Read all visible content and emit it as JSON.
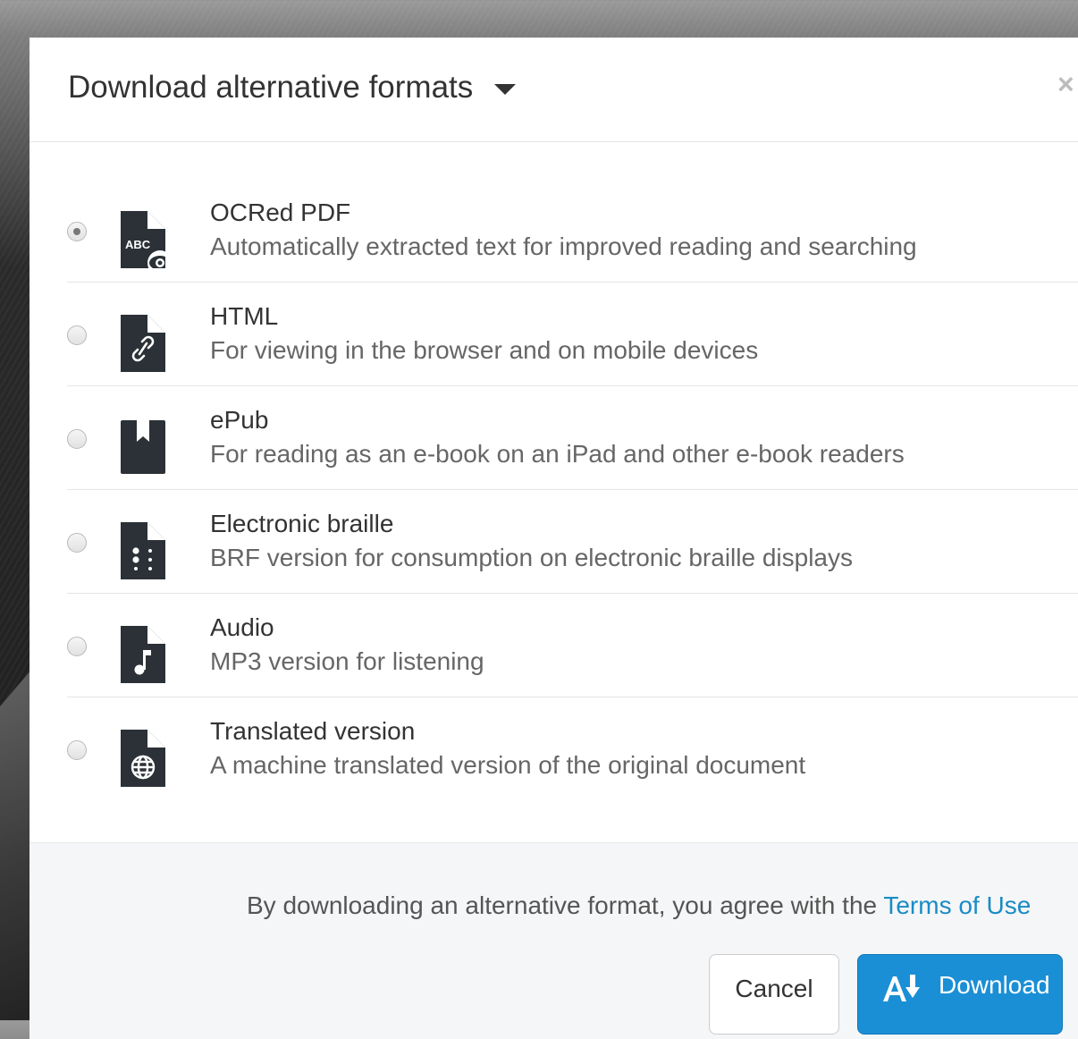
{
  "modal": {
    "title": "Download alternative formats",
    "close_label": "×"
  },
  "options": [
    {
      "title": "OCRed PDF",
      "description": "Automatically extracted text for improved reading and searching",
      "icon": "ocr-pdf-icon",
      "selected": true
    },
    {
      "title": "HTML",
      "description": "For viewing in the browser and on mobile devices",
      "icon": "html-link-icon",
      "selected": false
    },
    {
      "title": "ePub",
      "description": "For reading as an e-book on an iPad and other e-book readers",
      "icon": "epub-bookmark-icon",
      "selected": false
    },
    {
      "title": "Electronic braille",
      "description": "BRF version for consumption on electronic braille displays",
      "icon": "braille-icon",
      "selected": false
    },
    {
      "title": "Audio",
      "description": "MP3 version for listening",
      "icon": "audio-note-icon",
      "selected": false
    },
    {
      "title": "Translated version",
      "description": "A machine translated version of the original document",
      "icon": "globe-icon",
      "selected": false
    }
  ],
  "footer": {
    "terms_text": "By downloading an alternative format, you agree with the ",
    "terms_link": "Terms of Use",
    "cancel_label": "Cancel",
    "download_label": "Download"
  },
  "colors": {
    "accent": "#1a8fd6",
    "link": "#1a8bc5",
    "icon": "#2b3136",
    "text": "#333333",
    "muted_text": "#666666",
    "footer_bg": "#f5f6f7"
  }
}
